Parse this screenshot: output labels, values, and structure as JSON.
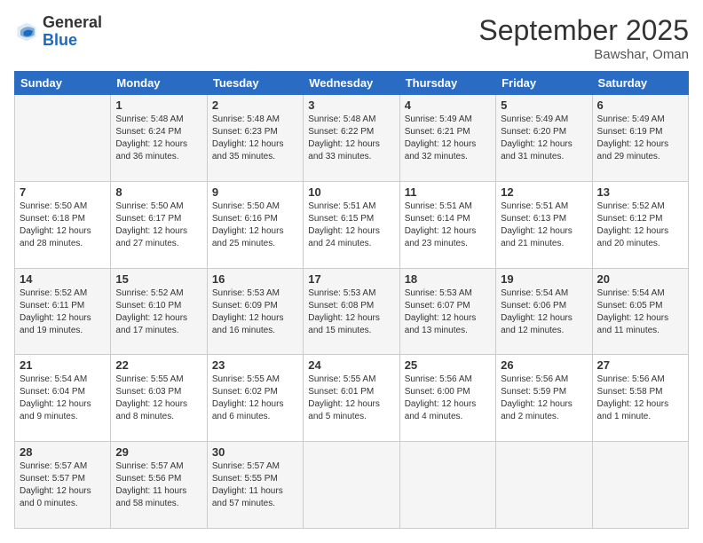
{
  "header": {
    "logo_general": "General",
    "logo_blue": "Blue",
    "month_title": "September 2025",
    "location": "Bawshar, Oman"
  },
  "days_of_week": [
    "Sunday",
    "Monday",
    "Tuesday",
    "Wednesday",
    "Thursday",
    "Friday",
    "Saturday"
  ],
  "weeks": [
    [
      {
        "day": "",
        "sunrise": "",
        "sunset": "",
        "daylight": ""
      },
      {
        "day": "1",
        "sunrise": "Sunrise: 5:48 AM",
        "sunset": "Sunset: 6:24 PM",
        "daylight": "Daylight: 12 hours and 36 minutes."
      },
      {
        "day": "2",
        "sunrise": "Sunrise: 5:48 AM",
        "sunset": "Sunset: 6:23 PM",
        "daylight": "Daylight: 12 hours and 35 minutes."
      },
      {
        "day": "3",
        "sunrise": "Sunrise: 5:48 AM",
        "sunset": "Sunset: 6:22 PM",
        "daylight": "Daylight: 12 hours and 33 minutes."
      },
      {
        "day": "4",
        "sunrise": "Sunrise: 5:49 AM",
        "sunset": "Sunset: 6:21 PM",
        "daylight": "Daylight: 12 hours and 32 minutes."
      },
      {
        "day": "5",
        "sunrise": "Sunrise: 5:49 AM",
        "sunset": "Sunset: 6:20 PM",
        "daylight": "Daylight: 12 hours and 31 minutes."
      },
      {
        "day": "6",
        "sunrise": "Sunrise: 5:49 AM",
        "sunset": "Sunset: 6:19 PM",
        "daylight": "Daylight: 12 hours and 29 minutes."
      }
    ],
    [
      {
        "day": "7",
        "sunrise": "Sunrise: 5:50 AM",
        "sunset": "Sunset: 6:18 PM",
        "daylight": "Daylight: 12 hours and 28 minutes."
      },
      {
        "day": "8",
        "sunrise": "Sunrise: 5:50 AM",
        "sunset": "Sunset: 6:17 PM",
        "daylight": "Daylight: 12 hours and 27 minutes."
      },
      {
        "day": "9",
        "sunrise": "Sunrise: 5:50 AM",
        "sunset": "Sunset: 6:16 PM",
        "daylight": "Daylight: 12 hours and 25 minutes."
      },
      {
        "day": "10",
        "sunrise": "Sunrise: 5:51 AM",
        "sunset": "Sunset: 6:15 PM",
        "daylight": "Daylight: 12 hours and 24 minutes."
      },
      {
        "day": "11",
        "sunrise": "Sunrise: 5:51 AM",
        "sunset": "Sunset: 6:14 PM",
        "daylight": "Daylight: 12 hours and 23 minutes."
      },
      {
        "day": "12",
        "sunrise": "Sunrise: 5:51 AM",
        "sunset": "Sunset: 6:13 PM",
        "daylight": "Daylight: 12 hours and 21 minutes."
      },
      {
        "day": "13",
        "sunrise": "Sunrise: 5:52 AM",
        "sunset": "Sunset: 6:12 PM",
        "daylight": "Daylight: 12 hours and 20 minutes."
      }
    ],
    [
      {
        "day": "14",
        "sunrise": "Sunrise: 5:52 AM",
        "sunset": "Sunset: 6:11 PM",
        "daylight": "Daylight: 12 hours and 19 minutes."
      },
      {
        "day": "15",
        "sunrise": "Sunrise: 5:52 AM",
        "sunset": "Sunset: 6:10 PM",
        "daylight": "Daylight: 12 hours and 17 minutes."
      },
      {
        "day": "16",
        "sunrise": "Sunrise: 5:53 AM",
        "sunset": "Sunset: 6:09 PM",
        "daylight": "Daylight: 12 hours and 16 minutes."
      },
      {
        "day": "17",
        "sunrise": "Sunrise: 5:53 AM",
        "sunset": "Sunset: 6:08 PM",
        "daylight": "Daylight: 12 hours and 15 minutes."
      },
      {
        "day": "18",
        "sunrise": "Sunrise: 5:53 AM",
        "sunset": "Sunset: 6:07 PM",
        "daylight": "Daylight: 12 hours and 13 minutes."
      },
      {
        "day": "19",
        "sunrise": "Sunrise: 5:54 AM",
        "sunset": "Sunset: 6:06 PM",
        "daylight": "Daylight: 12 hours and 12 minutes."
      },
      {
        "day": "20",
        "sunrise": "Sunrise: 5:54 AM",
        "sunset": "Sunset: 6:05 PM",
        "daylight": "Daylight: 12 hours and 11 minutes."
      }
    ],
    [
      {
        "day": "21",
        "sunrise": "Sunrise: 5:54 AM",
        "sunset": "Sunset: 6:04 PM",
        "daylight": "Daylight: 12 hours and 9 minutes."
      },
      {
        "day": "22",
        "sunrise": "Sunrise: 5:55 AM",
        "sunset": "Sunset: 6:03 PM",
        "daylight": "Daylight: 12 hours and 8 minutes."
      },
      {
        "day": "23",
        "sunrise": "Sunrise: 5:55 AM",
        "sunset": "Sunset: 6:02 PM",
        "daylight": "Daylight: 12 hours and 6 minutes."
      },
      {
        "day": "24",
        "sunrise": "Sunrise: 5:55 AM",
        "sunset": "Sunset: 6:01 PM",
        "daylight": "Daylight: 12 hours and 5 minutes."
      },
      {
        "day": "25",
        "sunrise": "Sunrise: 5:56 AM",
        "sunset": "Sunset: 6:00 PM",
        "daylight": "Daylight: 12 hours and 4 minutes."
      },
      {
        "day": "26",
        "sunrise": "Sunrise: 5:56 AM",
        "sunset": "Sunset: 5:59 PM",
        "daylight": "Daylight: 12 hours and 2 minutes."
      },
      {
        "day": "27",
        "sunrise": "Sunrise: 5:56 AM",
        "sunset": "Sunset: 5:58 PM",
        "daylight": "Daylight: 12 hours and 1 minute."
      }
    ],
    [
      {
        "day": "28",
        "sunrise": "Sunrise: 5:57 AM",
        "sunset": "Sunset: 5:57 PM",
        "daylight": "Daylight: 12 hours and 0 minutes."
      },
      {
        "day": "29",
        "sunrise": "Sunrise: 5:57 AM",
        "sunset": "Sunset: 5:56 PM",
        "daylight": "Daylight: 11 hours and 58 minutes."
      },
      {
        "day": "30",
        "sunrise": "Sunrise: 5:57 AM",
        "sunset": "Sunset: 5:55 PM",
        "daylight": "Daylight: 11 hours and 57 minutes."
      },
      {
        "day": "",
        "sunrise": "",
        "sunset": "",
        "daylight": ""
      },
      {
        "day": "",
        "sunrise": "",
        "sunset": "",
        "daylight": ""
      },
      {
        "day": "",
        "sunrise": "",
        "sunset": "",
        "daylight": ""
      },
      {
        "day": "",
        "sunrise": "",
        "sunset": "",
        "daylight": ""
      }
    ]
  ]
}
